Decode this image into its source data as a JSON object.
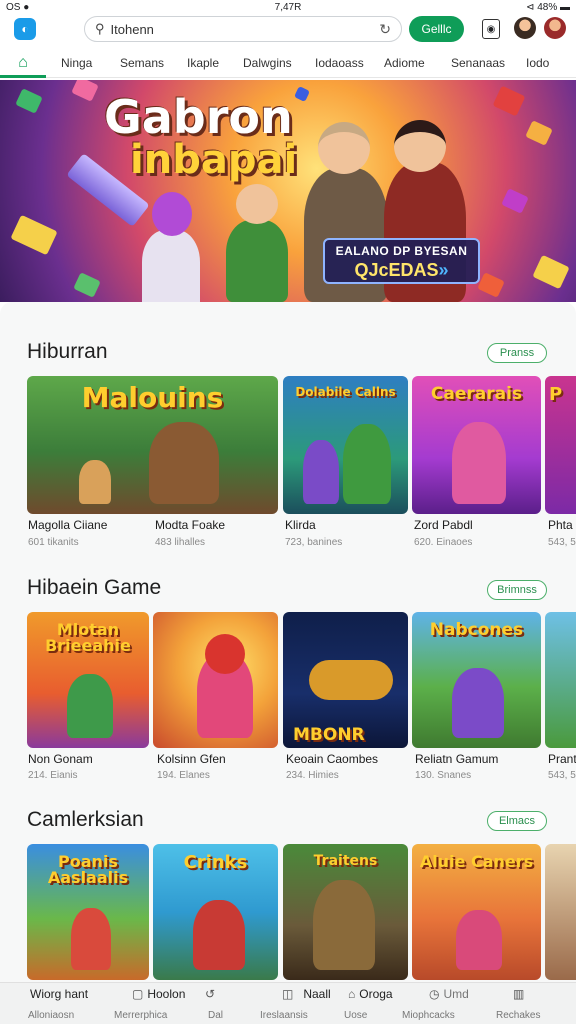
{
  "status": {
    "left": "OS ●",
    "center": "7,47R",
    "right": "⊲ 48% ▬"
  },
  "topbar": {
    "search_text": "Itohenn",
    "green_button": "Gelllc"
  },
  "tabs": [
    "Ninga",
    "Semans",
    "Ikaple",
    "Dalwgins",
    "Iodaoass",
    "Adiome",
    "Senanaas",
    "Iodo"
  ],
  "banner": {
    "title_line1": "Gabron",
    "title_line2": "inbapai",
    "badge_line1": "EALANO DP BYESAN",
    "badge_line2": "QJcEDAS",
    "badge_arrow": "»"
  },
  "sections": [
    {
      "title": "Hiburran",
      "more": "Pranss",
      "games": [
        {
          "logo": "Malouins",
          "title": "Magolla Ciiane",
          "sub": "601 tikanits"
        },
        {
          "logo": "",
          "title": "Modta Foake",
          "sub": "483 lihalles"
        },
        {
          "logo": "Dolabile Callns",
          "title": "Klirda",
          "sub": "723, banines"
        },
        {
          "logo": "Caerarais",
          "title": "Zord Pabdl",
          "sub": "620. Einaoes"
        },
        {
          "logo": "P",
          "title": "Phta",
          "sub": "543, 5"
        }
      ]
    },
    {
      "title": "Hibaein Game",
      "more": "Brimnss",
      "games": [
        {
          "logo": "Mlotan Brieeahie",
          "title": "Non Gonam",
          "sub": "214. Eianis"
        },
        {
          "logo": "",
          "title": "Kolsinn Gfen",
          "sub": "194. Elanes"
        },
        {
          "logo": "MBONR",
          "title": "Keoain Caombes",
          "sub": "234. Himies"
        },
        {
          "logo": "Nabcones",
          "title": "Reliatn Gamum",
          "sub": "130. Snanes"
        },
        {
          "logo": "",
          "title": "Prant",
          "sub": "543, 5"
        }
      ]
    },
    {
      "title": "Camlerksian",
      "more": "Elmacs",
      "games": [
        {
          "logo": "Poanis Aaslaalis",
          "title": "",
          "sub": ""
        },
        {
          "logo": "Crinks",
          "title": "",
          "sub": ""
        },
        {
          "logo": "Traitens",
          "title": "",
          "sub": ""
        },
        {
          "logo": "Aluie Caners",
          "title": "",
          "sub": ""
        },
        {
          "logo": "",
          "title": "",
          "sub": ""
        }
      ]
    }
  ],
  "bottomnav": [
    {
      "top": "Wiorg hant",
      "bottom": "Alloniaosn",
      "icon": ""
    },
    {
      "top": "Hoolon",
      "bottom": "Merrerphica",
      "icon": "▢"
    },
    {
      "top": "",
      "bottom": "Dal",
      "icon": "↺"
    },
    {
      "top": "Naall",
      "bottom": "Ireslaansis",
      "icon": "◫"
    },
    {
      "top": "Oroga",
      "bottom": "Uose",
      "icon": "⌂"
    },
    {
      "top": "Umd",
      "bottom": "Miophcacks",
      "icon": "◷"
    },
    {
      "top": "",
      "bottom": "Rechakes",
      "icon": "▥"
    }
  ],
  "colors": {
    "accent_green": "#0f9d58",
    "app_icon_blue": "#1a9be8"
  }
}
